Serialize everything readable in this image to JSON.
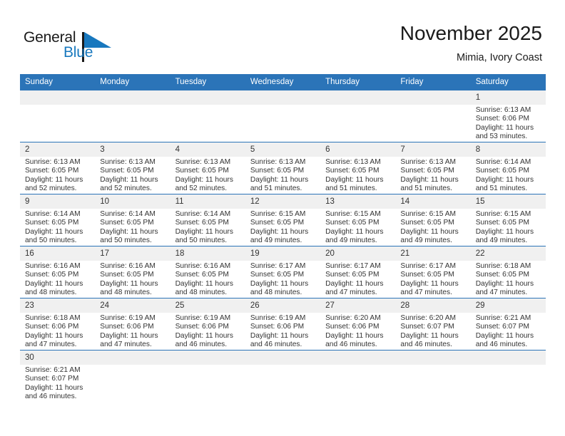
{
  "brand": {
    "name_part1": "General",
    "name_part2": "Blue",
    "accent_color": "#1878be",
    "triangle_color": "#1878be"
  },
  "header": {
    "month_title": "November 2025",
    "location": "Mimia, Ivory Coast"
  },
  "theme": {
    "header_blue": "#2b74b8",
    "daynum_gray": "#f0f0f0",
    "text_color": "#333333"
  },
  "weekday_headers": [
    "Sunday",
    "Monday",
    "Tuesday",
    "Wednesday",
    "Thursday",
    "Friday",
    "Saturday"
  ],
  "labels": {
    "sunrise_prefix": "Sunrise:",
    "sunset_prefix": "Sunset:",
    "daylight_prefix": "Daylight:"
  },
  "weeks": [
    [
      {
        "day": "",
        "sunrise": "",
        "sunset": "",
        "daylight": "",
        "empty": true
      },
      {
        "day": "",
        "sunrise": "",
        "sunset": "",
        "daylight": "",
        "empty": true
      },
      {
        "day": "",
        "sunrise": "",
        "sunset": "",
        "daylight": "",
        "empty": true
      },
      {
        "day": "",
        "sunrise": "",
        "sunset": "",
        "daylight": "",
        "empty": true
      },
      {
        "day": "",
        "sunrise": "",
        "sunset": "",
        "daylight": "",
        "empty": true
      },
      {
        "day": "",
        "sunrise": "",
        "sunset": "",
        "daylight": "",
        "empty": true
      },
      {
        "day": "1",
        "sunrise": "Sunrise: 6:13 AM",
        "sunset": "Sunset: 6:06 PM",
        "daylight": "Daylight: 11 hours and 53 minutes.",
        "empty": false
      }
    ],
    [
      {
        "day": "2",
        "sunrise": "Sunrise: 6:13 AM",
        "sunset": "Sunset: 6:05 PM",
        "daylight": "Daylight: 11 hours and 52 minutes.",
        "empty": false
      },
      {
        "day": "3",
        "sunrise": "Sunrise: 6:13 AM",
        "sunset": "Sunset: 6:05 PM",
        "daylight": "Daylight: 11 hours and 52 minutes.",
        "empty": false
      },
      {
        "day": "4",
        "sunrise": "Sunrise: 6:13 AM",
        "sunset": "Sunset: 6:05 PM",
        "daylight": "Daylight: 11 hours and 52 minutes.",
        "empty": false
      },
      {
        "day": "5",
        "sunrise": "Sunrise: 6:13 AM",
        "sunset": "Sunset: 6:05 PM",
        "daylight": "Daylight: 11 hours and 51 minutes.",
        "empty": false
      },
      {
        "day": "6",
        "sunrise": "Sunrise: 6:13 AM",
        "sunset": "Sunset: 6:05 PM",
        "daylight": "Daylight: 11 hours and 51 minutes.",
        "empty": false
      },
      {
        "day": "7",
        "sunrise": "Sunrise: 6:13 AM",
        "sunset": "Sunset: 6:05 PM",
        "daylight": "Daylight: 11 hours and 51 minutes.",
        "empty": false
      },
      {
        "day": "8",
        "sunrise": "Sunrise: 6:14 AM",
        "sunset": "Sunset: 6:05 PM",
        "daylight": "Daylight: 11 hours and 51 minutes.",
        "empty": false
      }
    ],
    [
      {
        "day": "9",
        "sunrise": "Sunrise: 6:14 AM",
        "sunset": "Sunset: 6:05 PM",
        "daylight": "Daylight: 11 hours and 50 minutes.",
        "empty": false
      },
      {
        "day": "10",
        "sunrise": "Sunrise: 6:14 AM",
        "sunset": "Sunset: 6:05 PM",
        "daylight": "Daylight: 11 hours and 50 minutes.",
        "empty": false
      },
      {
        "day": "11",
        "sunrise": "Sunrise: 6:14 AM",
        "sunset": "Sunset: 6:05 PM",
        "daylight": "Daylight: 11 hours and 50 minutes.",
        "empty": false
      },
      {
        "day": "12",
        "sunrise": "Sunrise: 6:15 AM",
        "sunset": "Sunset: 6:05 PM",
        "daylight": "Daylight: 11 hours and 49 minutes.",
        "empty": false
      },
      {
        "day": "13",
        "sunrise": "Sunrise: 6:15 AM",
        "sunset": "Sunset: 6:05 PM",
        "daylight": "Daylight: 11 hours and 49 minutes.",
        "empty": false
      },
      {
        "day": "14",
        "sunrise": "Sunrise: 6:15 AM",
        "sunset": "Sunset: 6:05 PM",
        "daylight": "Daylight: 11 hours and 49 minutes.",
        "empty": false
      },
      {
        "day": "15",
        "sunrise": "Sunrise: 6:15 AM",
        "sunset": "Sunset: 6:05 PM",
        "daylight": "Daylight: 11 hours and 49 minutes.",
        "empty": false
      }
    ],
    [
      {
        "day": "16",
        "sunrise": "Sunrise: 6:16 AM",
        "sunset": "Sunset: 6:05 PM",
        "daylight": "Daylight: 11 hours and 48 minutes.",
        "empty": false
      },
      {
        "day": "17",
        "sunrise": "Sunrise: 6:16 AM",
        "sunset": "Sunset: 6:05 PM",
        "daylight": "Daylight: 11 hours and 48 minutes.",
        "empty": false
      },
      {
        "day": "18",
        "sunrise": "Sunrise: 6:16 AM",
        "sunset": "Sunset: 6:05 PM",
        "daylight": "Daylight: 11 hours and 48 minutes.",
        "empty": false
      },
      {
        "day": "19",
        "sunrise": "Sunrise: 6:17 AM",
        "sunset": "Sunset: 6:05 PM",
        "daylight": "Daylight: 11 hours and 48 minutes.",
        "empty": false
      },
      {
        "day": "20",
        "sunrise": "Sunrise: 6:17 AM",
        "sunset": "Sunset: 6:05 PM",
        "daylight": "Daylight: 11 hours and 47 minutes.",
        "empty": false
      },
      {
        "day": "21",
        "sunrise": "Sunrise: 6:17 AM",
        "sunset": "Sunset: 6:05 PM",
        "daylight": "Daylight: 11 hours and 47 minutes.",
        "empty": false
      },
      {
        "day": "22",
        "sunrise": "Sunrise: 6:18 AM",
        "sunset": "Sunset: 6:05 PM",
        "daylight": "Daylight: 11 hours and 47 minutes.",
        "empty": false
      }
    ],
    [
      {
        "day": "23",
        "sunrise": "Sunrise: 6:18 AM",
        "sunset": "Sunset: 6:06 PM",
        "daylight": "Daylight: 11 hours and 47 minutes.",
        "empty": false
      },
      {
        "day": "24",
        "sunrise": "Sunrise: 6:19 AM",
        "sunset": "Sunset: 6:06 PM",
        "daylight": "Daylight: 11 hours and 47 minutes.",
        "empty": false
      },
      {
        "day": "25",
        "sunrise": "Sunrise: 6:19 AM",
        "sunset": "Sunset: 6:06 PM",
        "daylight": "Daylight: 11 hours and 46 minutes.",
        "empty": false
      },
      {
        "day": "26",
        "sunrise": "Sunrise: 6:19 AM",
        "sunset": "Sunset: 6:06 PM",
        "daylight": "Daylight: 11 hours and 46 minutes.",
        "empty": false
      },
      {
        "day": "27",
        "sunrise": "Sunrise: 6:20 AM",
        "sunset": "Sunset: 6:06 PM",
        "daylight": "Daylight: 11 hours and 46 minutes.",
        "empty": false
      },
      {
        "day": "28",
        "sunrise": "Sunrise: 6:20 AM",
        "sunset": "Sunset: 6:07 PM",
        "daylight": "Daylight: 11 hours and 46 minutes.",
        "empty": false
      },
      {
        "day": "29",
        "sunrise": "Sunrise: 6:21 AM",
        "sunset": "Sunset: 6:07 PM",
        "daylight": "Daylight: 11 hours and 46 minutes.",
        "empty": false
      }
    ],
    [
      {
        "day": "30",
        "sunrise": "Sunrise: 6:21 AM",
        "sunset": "Sunset: 6:07 PM",
        "daylight": "Daylight: 11 hours and 46 minutes.",
        "empty": false
      },
      {
        "day": "",
        "sunrise": "",
        "sunset": "",
        "daylight": "",
        "empty": true
      },
      {
        "day": "",
        "sunrise": "",
        "sunset": "",
        "daylight": "",
        "empty": true
      },
      {
        "day": "",
        "sunrise": "",
        "sunset": "",
        "daylight": "",
        "empty": true
      },
      {
        "day": "",
        "sunrise": "",
        "sunset": "",
        "daylight": "",
        "empty": true
      },
      {
        "day": "",
        "sunrise": "",
        "sunset": "",
        "daylight": "",
        "empty": true
      },
      {
        "day": "",
        "sunrise": "",
        "sunset": "",
        "daylight": "",
        "empty": true
      }
    ]
  ]
}
